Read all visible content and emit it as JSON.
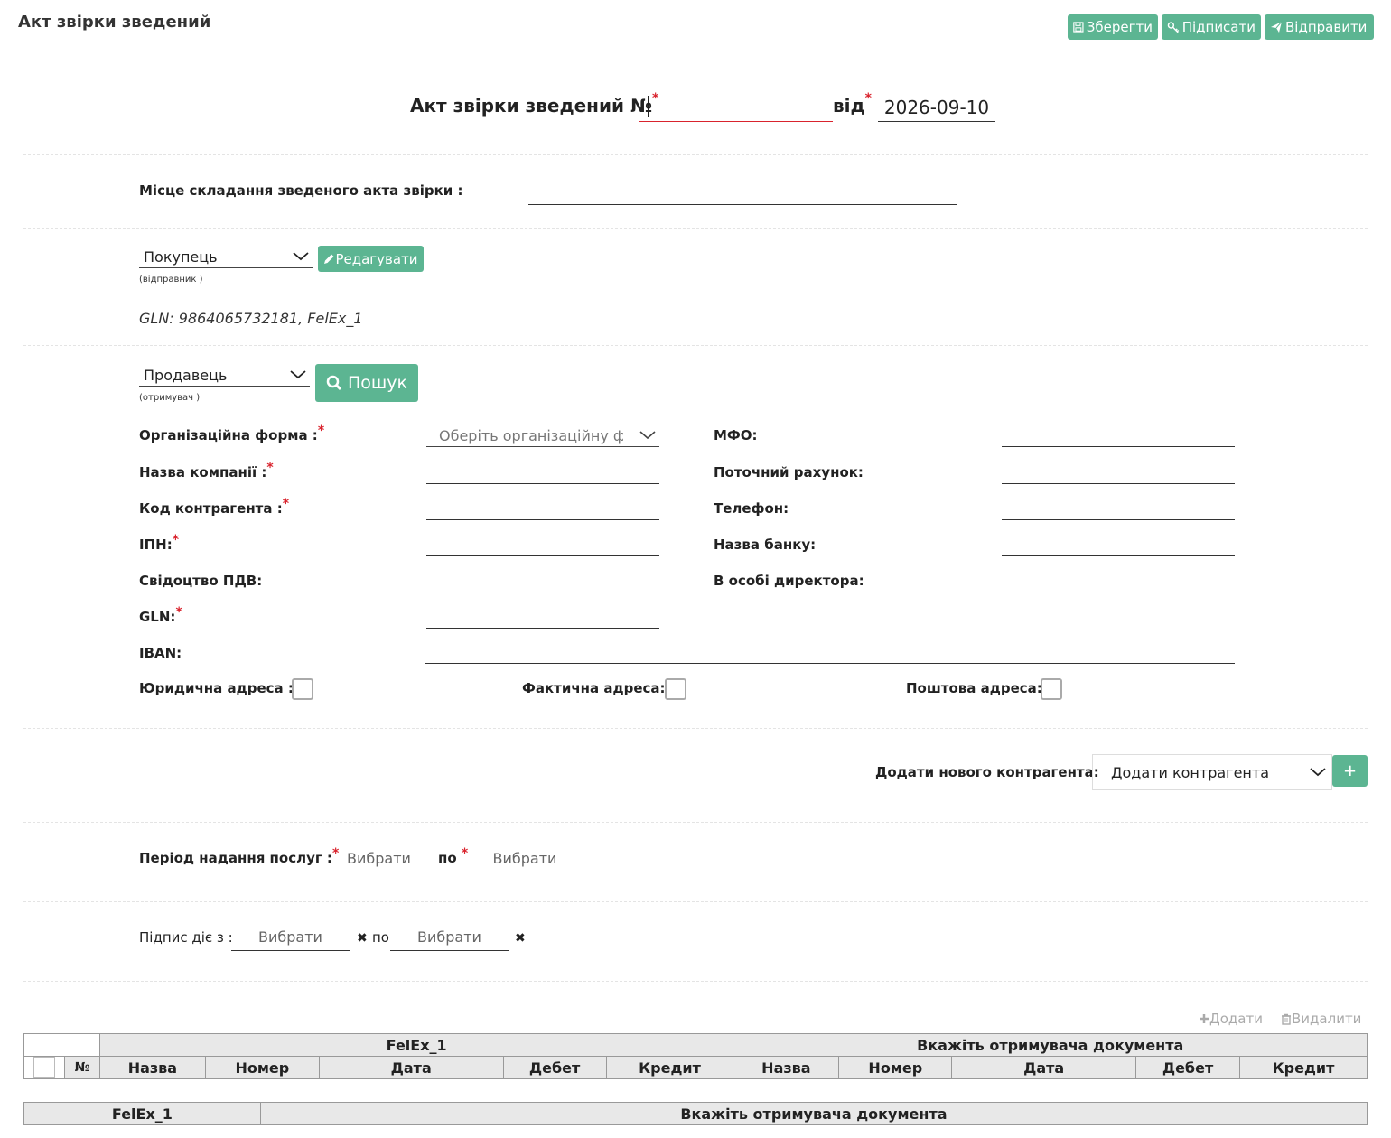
{
  "header": {
    "title": "Акт звірки зведений",
    "buttons": {
      "save": "Зберегти",
      "sign": "Підписати",
      "send": "Відправити"
    }
  },
  "doc": {
    "number_label": "Акт звірки зведений №",
    "number_value": "",
    "date_label": "від",
    "date_value": "2026-09-10"
  },
  "place": {
    "label": "Місце складання зведеного акта звірки :",
    "value": ""
  },
  "sender": {
    "role_selected": "Покупець",
    "role_hint": "(відправник )",
    "edit_button": "Редагувати",
    "info": "GLN: 9864065732181, FelEx_1"
  },
  "receiver": {
    "role_selected": "Продавець",
    "role_hint": "(отримувач )",
    "search_button": "Пошук",
    "fields_left": {
      "org_form": {
        "label": "Організаційна форма :",
        "placeholder": "Оберіть організаційну фор"
      },
      "company_name": {
        "label": "Назва компанії :"
      },
      "contractor_code": {
        "label": "Код контрагента :"
      },
      "ipn": {
        "label": "ІПН:"
      },
      "vat_cert": {
        "label": "Свідоцтво ПДВ:"
      },
      "gln": {
        "label": "GLN:"
      },
      "iban": {
        "label": "IBAN:"
      }
    },
    "fields_right": {
      "mfo": {
        "label": "МФО:"
      },
      "account": {
        "label": "Поточний рахунок:"
      },
      "phone": {
        "label": "Телефон:"
      },
      "bank": {
        "label": "Назва банку:"
      },
      "director": {
        "label": "В особі директора:"
      }
    },
    "addresses": {
      "legal": "Юридична адреса :",
      "actual": "Фактична адреса:",
      "postal": "Поштова адреса:"
    }
  },
  "add_contractor": {
    "label": "Додати нового контрагента:",
    "selected": "Додати контрагента",
    "plus": "+"
  },
  "period": {
    "label": "Період надання послуг :",
    "from": "Вибрати",
    "to_label": "по",
    "to": "Вибрати"
  },
  "signature": {
    "label": "Підпис діє з :",
    "from": "Вибрати",
    "to_label": "по",
    "to": "Вибрати",
    "clear": "✖"
  },
  "table": {
    "actions": {
      "add": "Додати",
      "delete": "Видалити"
    },
    "group_left": "FelEx_1",
    "group_right": "Вкажіть отримувача документа",
    "columns": [
      "№",
      "Назва",
      "Номер",
      "Дата",
      "Дебет",
      "Кредит",
      "Назва",
      "Номер",
      "Дата",
      "Дебет",
      "Кредит"
    ]
  },
  "summary": {
    "left": "FelEx_1",
    "right": "Вкажіть отримувача документа"
  }
}
